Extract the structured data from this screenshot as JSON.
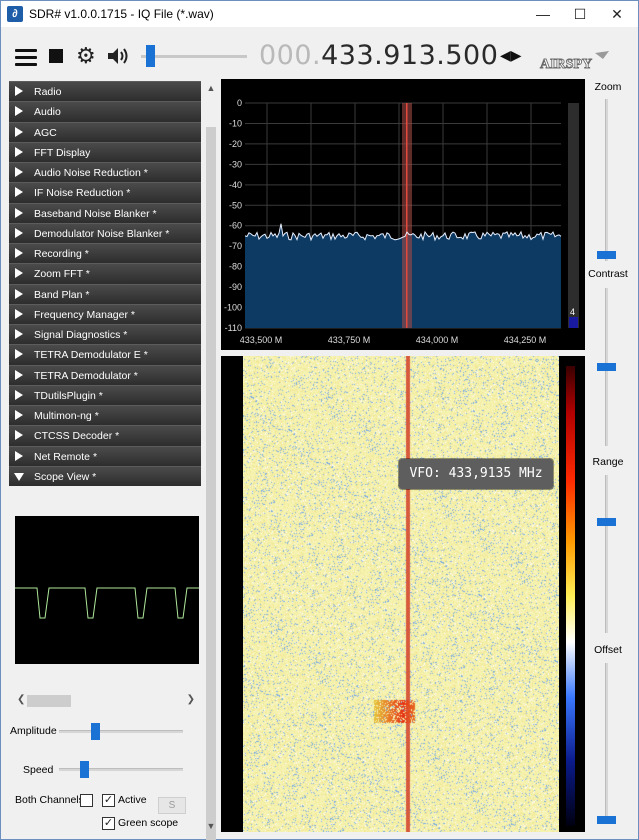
{
  "window": {
    "title": "SDR# v1.0.0.1715 - IQ File (*.wav)",
    "app_icon": "sdrsharp-icon",
    "buttons": [
      "—",
      "☐",
      "✕"
    ]
  },
  "toolbar": {
    "frequency_dim": "000.",
    "frequency": "433.913.500",
    "volume_level": 0.05,
    "logo_text": "AIRSPY"
  },
  "plugins": [
    {
      "label": "Radio",
      "expanded": false
    },
    {
      "label": "Audio",
      "expanded": false
    },
    {
      "label": "AGC",
      "expanded": false
    },
    {
      "label": "FFT Display",
      "expanded": false
    },
    {
      "label": "Audio Noise Reduction *",
      "expanded": false
    },
    {
      "label": "IF Noise Reduction *",
      "expanded": false
    },
    {
      "label": "Baseband Noise Blanker *",
      "expanded": false
    },
    {
      "label": "Demodulator Noise Blanker *",
      "expanded": false
    },
    {
      "label": "Recording *",
      "expanded": false
    },
    {
      "label": "Zoom FFT *",
      "expanded": false
    },
    {
      "label": "Band Plan *",
      "expanded": false
    },
    {
      "label": "Frequency Manager *",
      "expanded": false
    },
    {
      "label": "Signal Diagnostics *",
      "expanded": false
    },
    {
      "label": "TETRA Demodulator E *",
      "expanded": false
    },
    {
      "label": "TETRA Demodulator *",
      "expanded": false
    },
    {
      "label": "TDutilsPlugin *",
      "expanded": false
    },
    {
      "label": "Multimon-ng *",
      "expanded": false
    },
    {
      "label": "CTCSS Decoder *",
      "expanded": false
    },
    {
      "label": "Net Remote *",
      "expanded": false
    },
    {
      "label": "Scope View *",
      "expanded": true
    }
  ],
  "scope": {
    "amplitude_label": "Amplitude",
    "amplitude_value": 0.28,
    "speed_label": "Speed",
    "speed_value": 0.18,
    "both_channels_label": "Both Channels",
    "both_channels_checked": false,
    "active_label": "Active",
    "active_checked": true,
    "s_button_label": "S",
    "green_scope_label": "Green scope",
    "green_scope_checked": true
  },
  "spectrum": {
    "y_ticks": [
      "0",
      "-10",
      "-20",
      "-30",
      "-40",
      "-50",
      "-60",
      "-70",
      "-80",
      "-90",
      "-100",
      "-110"
    ],
    "x_ticks": [
      "433,500 M",
      "433,750 M",
      "434,000 M",
      "434,250 M"
    ],
    "level_readout": "4",
    "noise_floor_db": -62
  },
  "waterfall": {
    "vfo_label": "VFO: 433,9135 MHz"
  },
  "right_panel": {
    "zoom_label": "Zoom",
    "zoom_value": 0.04,
    "contrast_label": "Contrast",
    "contrast_value": 0.5,
    "range_label": "Range",
    "range_value": 0.7,
    "offset_label": "Offset",
    "offset_value": 0.02
  },
  "colors": {
    "accent": "#1a73d4",
    "spectrum_fill": "#0d3a63",
    "vfo_band": "#a04a46"
  }
}
